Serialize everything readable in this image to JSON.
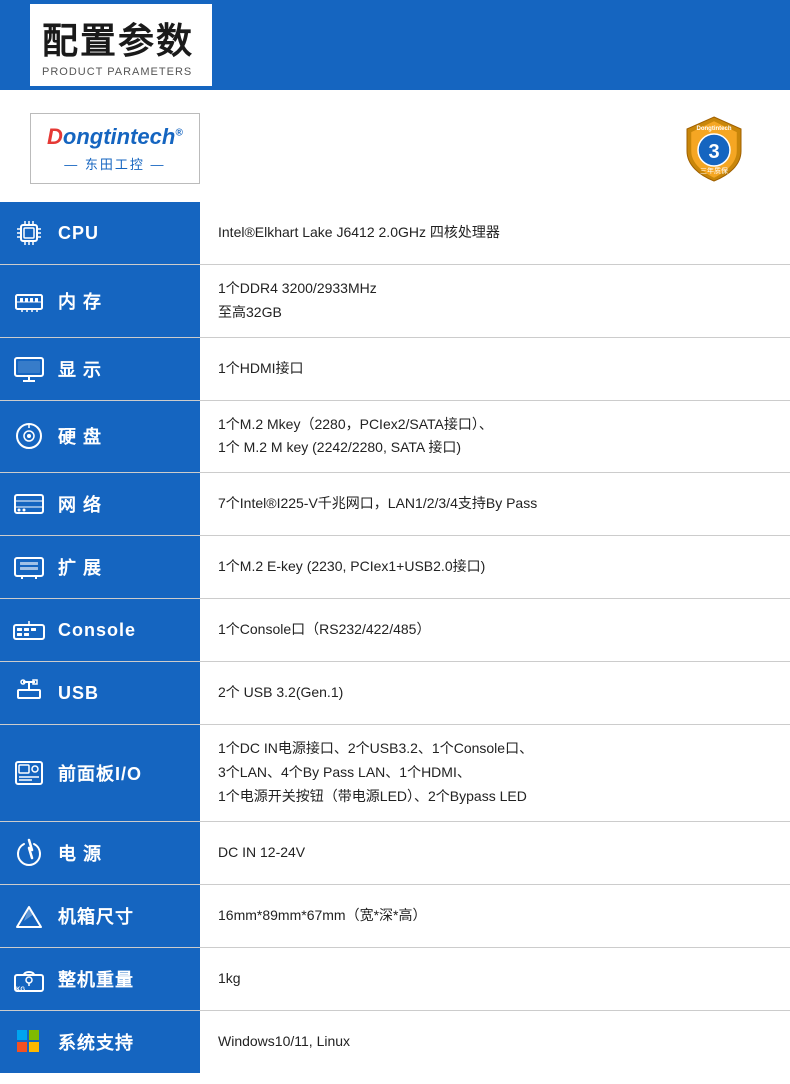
{
  "header": {
    "title": "配置参数",
    "subtitle": "PRODUCT PARAMETERS"
  },
  "logo": {
    "brand_prefix": "D",
    "brand_main": "ongtintech",
    "brand_reg": "®",
    "brand_cn": "— 东田工控 —"
  },
  "warranty": {
    "years": "3",
    "label": "三年质保"
  },
  "specs": [
    {
      "id": "cpu",
      "label": "CPU",
      "icon": "cpu",
      "value": "Intel®Elkhart Lake J6412 2.0GHz 四核处理器"
    },
    {
      "id": "memory",
      "label": "内 存",
      "icon": "memory",
      "value": "1个DDR4 3200/2933MHz\n至高32GB"
    },
    {
      "id": "display",
      "label": "显 示",
      "icon": "display",
      "value": "1个HDMI接口"
    },
    {
      "id": "storage",
      "label": "硬 盘",
      "icon": "storage",
      "value": "1个M.2 Mkey（2280，PCIex2/SATA接口）、\n1个 M.2 M key (2242/2280, SATA 接口)"
    },
    {
      "id": "network",
      "label": "网 络",
      "icon": "network",
      "value": "7个Intel®I225-V千兆网口，LAN1/2/3/4支持By Pass"
    },
    {
      "id": "expansion",
      "label": "扩 展",
      "icon": "expansion",
      "value": "1个M.2 E-key (2230, PCIex1+USB2.0接口)"
    },
    {
      "id": "console",
      "label": "Console",
      "icon": "console",
      "value": "1个Console口（RS232/422/485）"
    },
    {
      "id": "usb",
      "label": "USB",
      "icon": "usb",
      "value": "2个 USB 3.2(Gen.1)"
    },
    {
      "id": "frontpanel",
      "label": "前面板I/O",
      "icon": "frontpanel",
      "value": "1个DC IN电源接口、2个USB3.2、1个Console口、\n3个LAN、4个By Pass LAN、1个HDMI、\n1个电源开关按钮（带电源LED）、2个Bypass LED"
    },
    {
      "id": "power",
      "label": "电 源",
      "icon": "power",
      "value": "DC IN 12-24V"
    },
    {
      "id": "dimensions",
      "label": "机箱尺寸",
      "icon": "dimensions",
      "value": "16mm*89mm*67mm（宽*深*高）"
    },
    {
      "id": "weight",
      "label": "整机重量",
      "icon": "weight",
      "value": "1kg"
    },
    {
      "id": "os",
      "label": "系统支持",
      "icon": "os",
      "value": "Windows10/11, Linux"
    }
  ]
}
